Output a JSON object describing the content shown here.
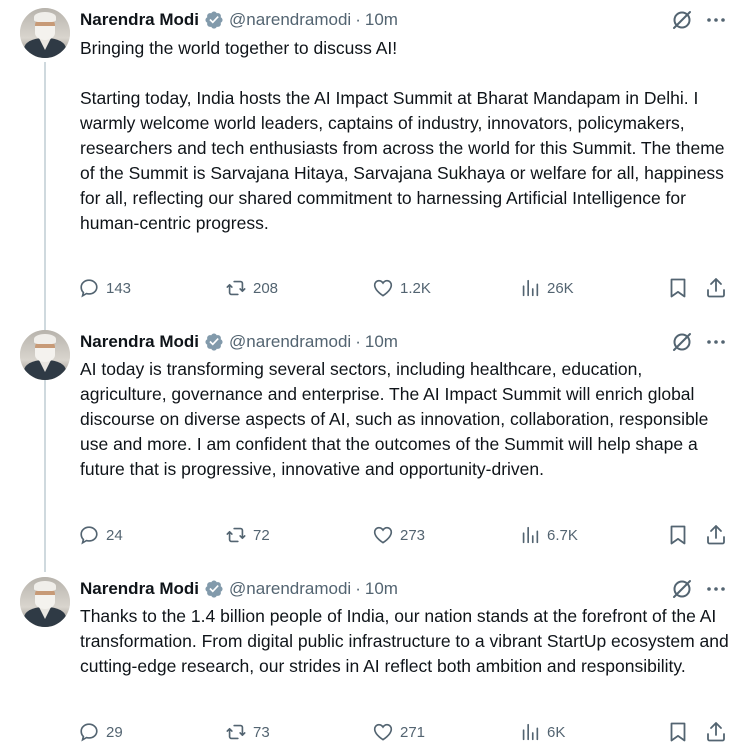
{
  "tweets": [
    {
      "author": {
        "name": "Narendra Modi",
        "handle": "@narendramodi",
        "time": "10m"
      },
      "text": "Bringing the world together to discuss AI!\n\nStarting today, India hosts the AI Impact Summit at Bharat Mandapam in Delhi. I warmly welcome world leaders, captains of industry, innovators, policymakers, researchers and tech enthusiasts from across the world for this Summit. The theme of the Summit is Sarvajana Hitaya, Sarvajana Sukhaya or welfare for all, happiness for all, reflecting our shared commitment to harnessing Artificial Intelligence for human-centric progress.",
      "stats": {
        "replies": "143",
        "reposts": "208",
        "likes": "1.2K",
        "views": "26K"
      }
    },
    {
      "author": {
        "name": "Narendra Modi",
        "handle": "@narendramodi",
        "time": "10m"
      },
      "text": "AI today is transforming several sectors, including healthcare, education, agriculture, governance and enterprise. The AI Impact Summit will enrich global discourse on diverse aspects of AI, such as innovation, collaboration, responsible use and more. I am confident that the outcomes of the Summit will help shape a future that is progressive, innovative and opportunity-driven.",
      "stats": {
        "replies": "24",
        "reposts": "72",
        "likes": "273",
        "views": "6.7K"
      }
    },
    {
      "author": {
        "name": "Narendra Modi",
        "handle": "@narendramodi",
        "time": "10m"
      },
      "text": "Thanks to the 1.4 billion people of India, our nation stands at the forefront of the AI transformation. From digital public infrastructure to a vibrant StartUp ecosystem and cutting-edge research, our strides in AI reflect both ambition and responsibility.",
      "stats": {
        "replies": "29",
        "reposts": "73",
        "likes": "271",
        "views": "6K"
      }
    }
  ],
  "ui": {
    "separator": "·"
  },
  "colors": {
    "text": "#0f1419",
    "secondary": "#536471",
    "verified_badge": "#829aab",
    "thread_line": "#cfd9de"
  },
  "icons": [
    "grok-icon",
    "more-icon",
    "reply-icon",
    "repost-icon",
    "like-icon",
    "views-icon",
    "bookmark-icon",
    "share-icon",
    "verified-badge-icon"
  ]
}
